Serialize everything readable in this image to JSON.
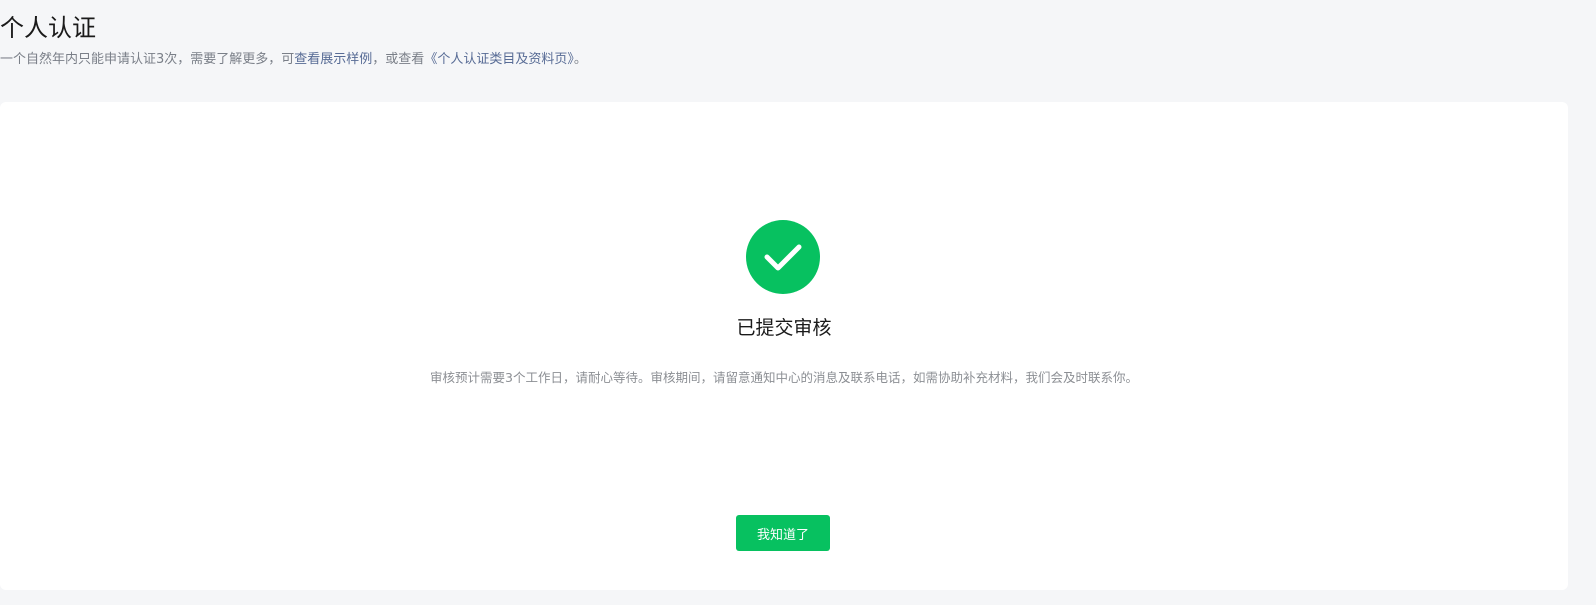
{
  "header": {
    "title": "个人认证",
    "description_prefix": "一个自然年内只能申请认证3次，需要了解更多，可",
    "example_link": "查看展示样例",
    "description_middle": "，或查看",
    "category_link": "《个人认证类目及资料页》",
    "description_suffix": "。"
  },
  "result": {
    "icon": "check-circle-icon",
    "title": "已提交审核",
    "description": "审核预计需要3个工作日，请耐心等待。审核期间，请留意通知中心的消息及联系电话，如需协助补充材料，我们会及时联系你。",
    "button_label": "我知道了"
  },
  "colors": {
    "accent": "#07c160",
    "link": "#576b95"
  }
}
